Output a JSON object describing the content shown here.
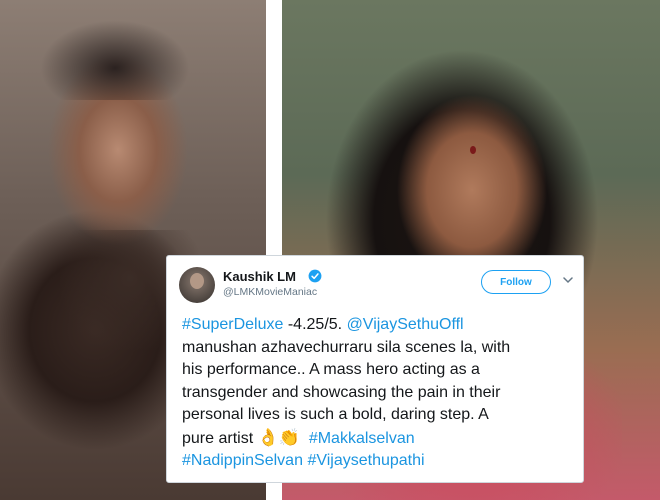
{
  "tweet": {
    "display_name": "Kaushik LM",
    "handle": "@LMKMovieManiac",
    "follow_label": "Follow",
    "lines": {
      "l1_hashtag": "#SuperDeluxe",
      "l1_text": " -4.25/5. ",
      "l1_mention": "@VijaySethuOffl",
      "l2": "manushan azhavechurraru sila scenes la, with",
      "l3": "his performance.. A mass hero acting as a",
      "l4": "transgender and showcasing the pain in their",
      "l5": "personal lives is such a bold, daring step. A",
      "l6_text": "pure artist ",
      "l6_emoji1": "👌",
      "l6_emoji2": "👏",
      "l6_hashtag": "#Makkalselvan",
      "l7_hashtag1": "#NadippinSelvan",
      "l7_hashtag2": "#Vijaysethupathi"
    }
  },
  "colors": {
    "link": "#1b95e0",
    "text": "#14171a",
    "muted": "#657786",
    "verified": "#1da1f2"
  },
  "icons": {
    "verified": "verified-badge-icon",
    "chevron": "chevron-down-icon"
  }
}
